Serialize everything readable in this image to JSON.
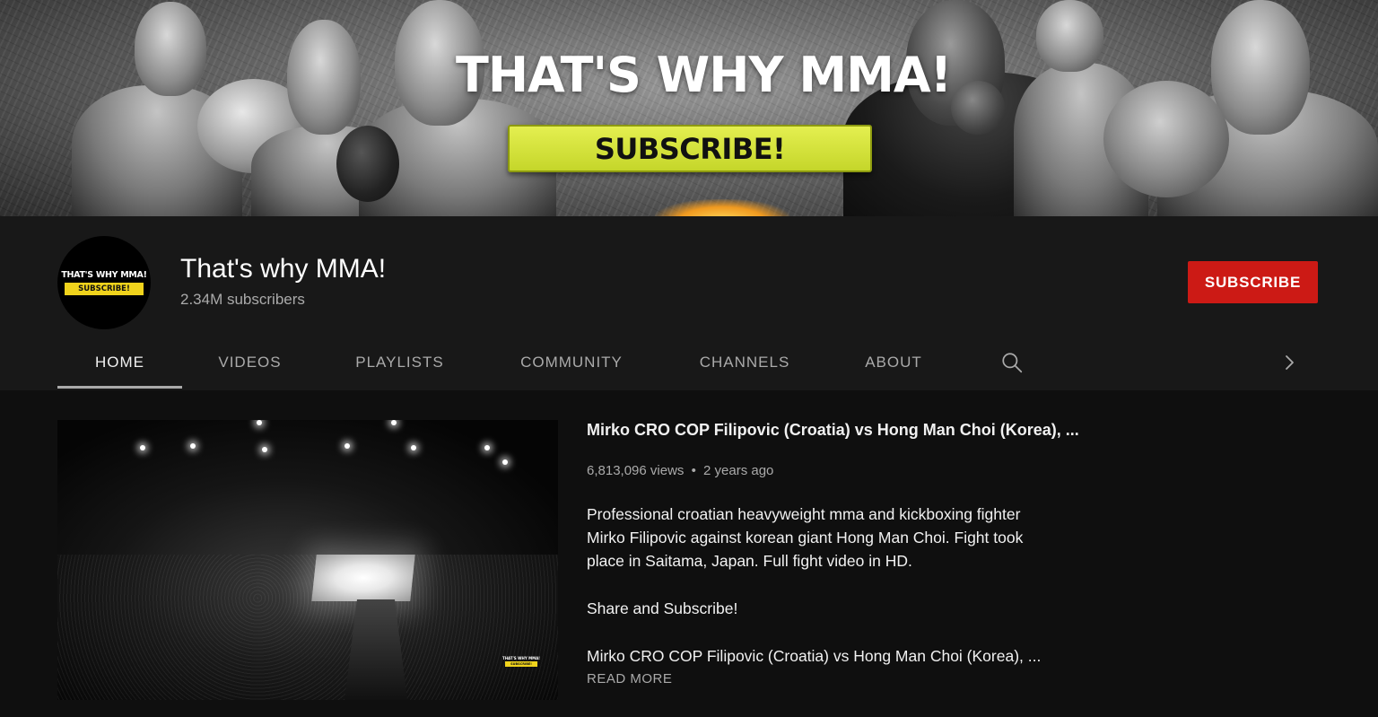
{
  "banner": {
    "title": "THAT'S WHY MMA!",
    "subscribe_label": "SUBSCRIBE!"
  },
  "channel": {
    "avatar_title": "THAT'S WHY MMA!",
    "avatar_subscribe": "SUBSCRIBE!",
    "name": "That's why MMA!",
    "subscribers": "2.34M subscribers",
    "subscribe_button": "SUBSCRIBE"
  },
  "tabs": [
    {
      "label": "HOME",
      "active": true
    },
    {
      "label": "VIDEOS"
    },
    {
      "label": "PLAYLISTS"
    },
    {
      "label": "COMMUNITY"
    },
    {
      "label": "CHANNELS"
    },
    {
      "label": "ABOUT"
    }
  ],
  "tab_icons": {
    "search": "search-icon",
    "next": "chevron-right-icon"
  },
  "featured": {
    "title": "Mirko CRO COP Filipovic (Croatia) vs Hong Man Choi (Korea), ...",
    "views": "6,813,096 views",
    "separator": "•",
    "age": "2 years ago",
    "description_lines": [
      "Professional croatian heavyweight mma and kickboxing fighter",
      "Mirko Filipovic against  korean giant Hong Man Choi. Fight took",
      "place in Saitama, Japan. Full fight video in HD.",
      "Share and Subscribe!",
      "Mirko CRO COP Filipovic (Croatia) vs Hong Man Choi (Korea), ..."
    ],
    "read_more": "READ MORE",
    "watermark_title": "THAT'S WHY MMA!",
    "watermark_sub": "SUBSCRIBE!"
  },
  "colors": {
    "background": "#181818",
    "content_background": "#0f0f0f",
    "subscribe_red": "#cc1a15",
    "banner_button": "#d9e63c",
    "secondary_text": "#aaaaaa"
  }
}
